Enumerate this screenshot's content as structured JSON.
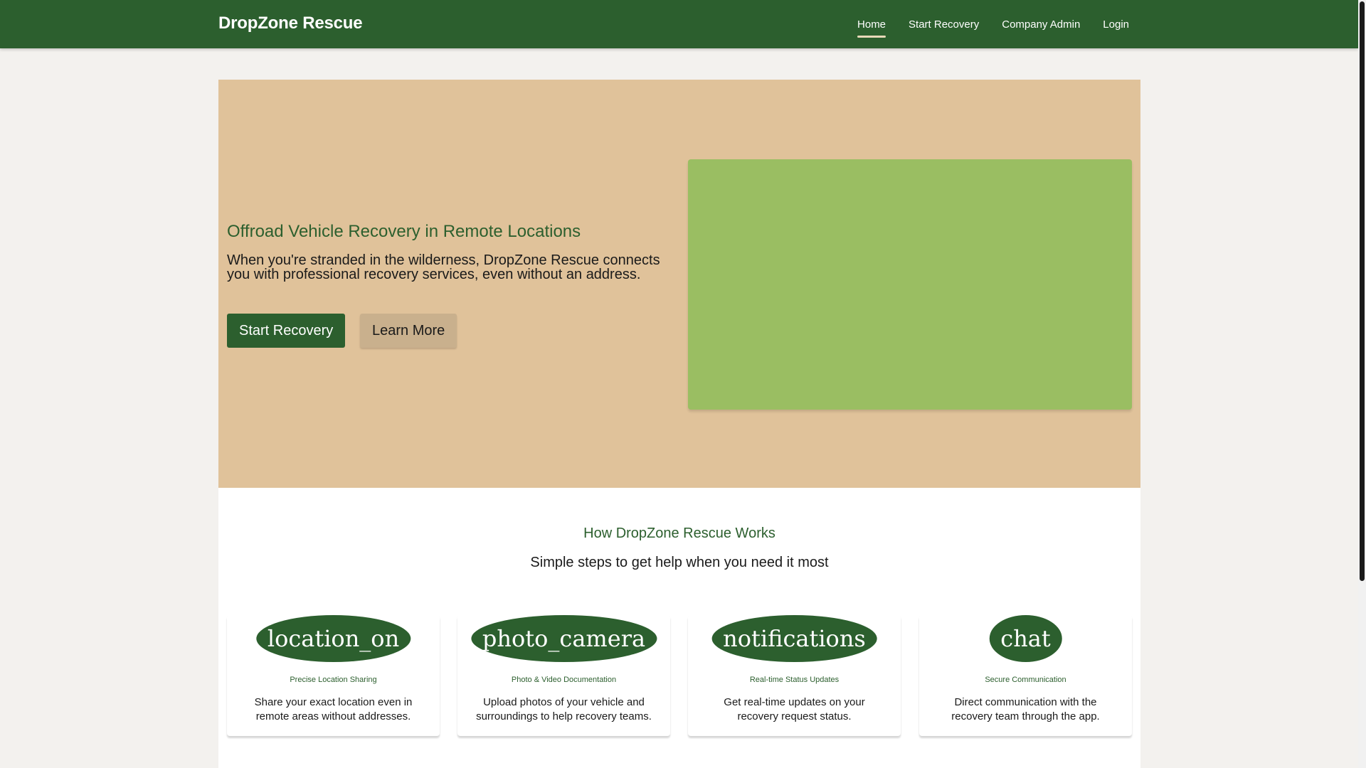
{
  "header": {
    "brand": "DropZone Rescue",
    "nav": [
      {
        "label": "Home",
        "active": true
      },
      {
        "label": "Start Recovery",
        "active": false
      },
      {
        "label": "Company Admin",
        "active": false
      },
      {
        "label": "Login",
        "active": false
      }
    ]
  },
  "hero": {
    "title": "Offroad Vehicle Recovery in Remote Locations",
    "text": "When you're stranded in the wilderness, DropZone Rescue connects you with professional recovery services, even without an address.",
    "primary_button": "Start Recovery",
    "secondary_button": "Learn More"
  },
  "how": {
    "title": "How DropZone Rescue Works",
    "subtitle": "Simple steps to get help when you need it most",
    "features": [
      {
        "icon": "location_on",
        "title": "Precise Location Sharing",
        "text": "Share your exact location even in remote areas without addresses."
      },
      {
        "icon": "photo_camera",
        "title": "Photo & Video Documentation",
        "text": "Upload photos of your vehicle and surroundings to help recovery teams."
      },
      {
        "icon": "notifications",
        "title": "Real-time Status Updates",
        "text": "Get real-time updates on your recovery request status."
      },
      {
        "icon": "chat",
        "title": "Secure Communication",
        "text": "Direct communication with the recovery team through the app."
      }
    ]
  },
  "colors": {
    "primary": "#2c5f2e",
    "hero_bg": "#e0c29a",
    "hero_image": "#9abe62",
    "secondary_button": "#c9b08d"
  }
}
